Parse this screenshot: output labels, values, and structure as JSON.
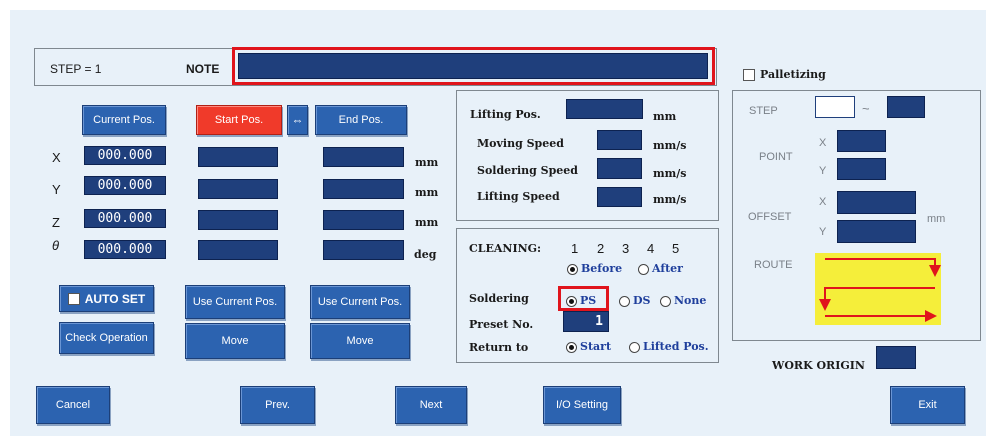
{
  "header": {
    "step_label": "STEP = 1",
    "note_label": "NOTE",
    "note_value": ""
  },
  "buttons": {
    "current_pos": "Current Pos.",
    "start_pos": "Start Pos.",
    "swap": "⇔",
    "end_pos": "End Pos.",
    "auto_set": "AUTO SET",
    "check_operation": "Check Operation",
    "use_current_start": "Use Current Pos.",
    "use_current_end": "Use Current Pos.",
    "move_start": "Move",
    "move_end": "Move",
    "cancel": "Cancel",
    "prev": "Prev.",
    "next": "Next",
    "io_setting": "I/O Setting",
    "exit": "Exit"
  },
  "axes": [
    {
      "name": "X",
      "current": "000.000",
      "unit": "mm"
    },
    {
      "name": "Y",
      "current": "000.000",
      "unit": "mm"
    },
    {
      "name": "Z",
      "current": "000.000",
      "unit": "mm"
    },
    {
      "name": "θ",
      "current": "000.000",
      "unit": "deg"
    }
  ],
  "speeds": {
    "lifting_pos": "Lifting Pos.",
    "lifting_pos_unit": "mm",
    "moving_speed": "Moving Speed",
    "moving_speed_unit": "mm/s",
    "soldering_speed": "Soldering Speed",
    "soldering_speed_unit": "mm/s",
    "lifting_speed": "Lifting Speed",
    "lifting_speed_unit": "mm/s"
  },
  "cleaning": {
    "label": "CLEANING:",
    "numbers": [
      "1",
      "2",
      "3",
      "4",
      "5"
    ],
    "before": "Before",
    "after": "After",
    "selected": "Before"
  },
  "soldering": {
    "label": "Soldering",
    "ps": "PS",
    "ds": "DS",
    "none": "None",
    "selected": "PS"
  },
  "preset": {
    "label": "Preset No.",
    "value": "1"
  },
  "return_to": {
    "label": "Return to",
    "start": "Start",
    "lifted": "Lifted Pos.",
    "selected": "Start"
  },
  "palletizing": {
    "label": "Palletizing",
    "checked": false,
    "step": "STEP",
    "tilde": "~",
    "point": "POINT",
    "offset": "OFFSET",
    "x": "X",
    "y": "Y",
    "unit": "mm",
    "route": "ROUTE"
  },
  "work_origin": {
    "label": "WORK ORIGIN"
  },
  "colors": {
    "field": "#1f3f7c",
    "button": "#2c63b0",
    "start_button": "#f03a2a",
    "highlight": "#e0141c",
    "route_fill": "#f5ee3a"
  }
}
